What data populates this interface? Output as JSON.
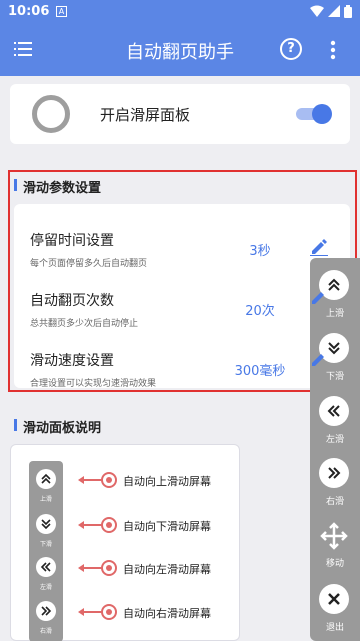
{
  "status_bar": {
    "time": "10:06",
    "sim_label": "A"
  },
  "app_bar": {
    "title": "自动翻页助手",
    "help_label": "?"
  },
  "toggle_card": {
    "label": "开启滑屏面板",
    "enabled": true
  },
  "params_section": {
    "title": "滑动参数设置",
    "rows": [
      {
        "title": "停留时间设置",
        "desc": "每个页面停留多久后自动翻页",
        "value": "3秒"
      },
      {
        "title": "自动翻页次数",
        "desc": "总共翻页多少次后自动停止",
        "value": "20次"
      },
      {
        "title": "滑动速度设置",
        "desc": "合理设置可以实现匀速滑动效果",
        "value": "300毫秒"
      }
    ]
  },
  "desc_section": {
    "title": "滑动面板说明",
    "items": [
      {
        "mini_label": "上滑",
        "text": "自动向上滑动屏幕"
      },
      {
        "mini_label": "下滑",
        "text": "自动向下滑动屏幕"
      },
      {
        "mini_label": "左滑",
        "text": "自动向左滑动屏幕"
      },
      {
        "mini_label": "右滑",
        "text": "自动向右滑动屏幕"
      }
    ]
  },
  "floating_panel": {
    "buttons": [
      {
        "label": "上滑",
        "icon": "double-chevron-up-icon"
      },
      {
        "label": "下滑",
        "icon": "double-chevron-down-icon"
      },
      {
        "label": "左滑",
        "icon": "double-chevron-left-icon"
      },
      {
        "label": "右滑",
        "icon": "double-chevron-right-icon"
      },
      {
        "label": "移动",
        "icon": "move-icon"
      },
      {
        "label": "退出",
        "icon": "close-icon"
      }
    ]
  },
  "colors": {
    "accent": "#5b86e5",
    "highlight_border": "#e03131",
    "panel_gray": "#9a9a9a"
  }
}
